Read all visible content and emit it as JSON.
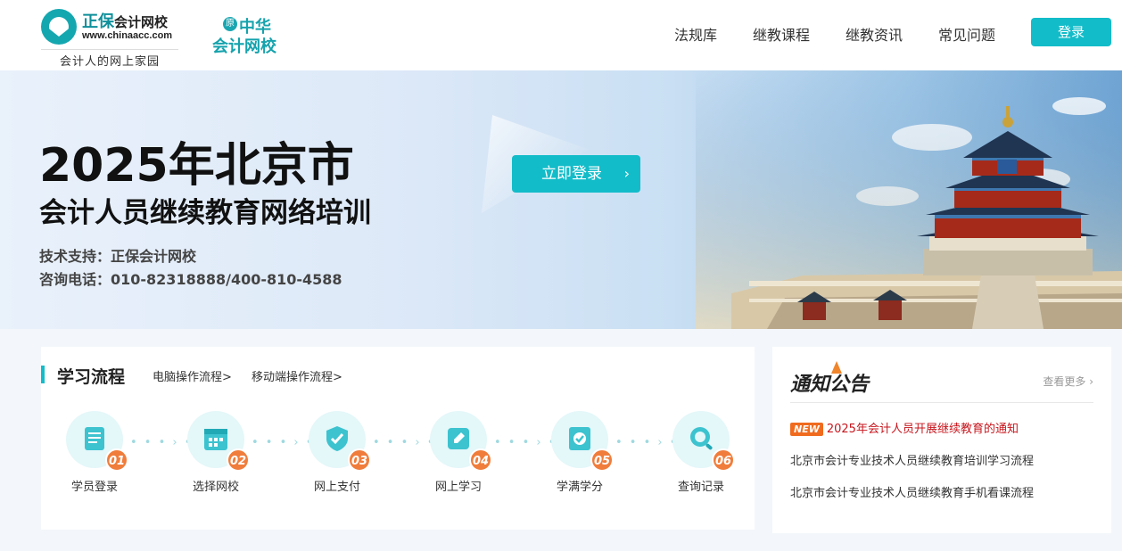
{
  "header": {
    "logo1_name": "正保",
    "logo1_name_suffix": "会计网校",
    "logo1_url": "www.chinaacc.com",
    "logo1_slogan": "会计人的网上家园",
    "logo2_badge": "原",
    "logo2_top": "中华",
    "logo2_bottom": "会计网校",
    "nav": [
      "法规库",
      "继教课程",
      "继教资讯",
      "常见问题"
    ],
    "login_label": "登录"
  },
  "banner": {
    "title": "2025年北京市",
    "subtitle": "会计人员继续教育网络培训",
    "support": "技术支持：正保会计网校",
    "phone": "咨询电话：010-82318888/400-810-4588",
    "cta_label": "立即登录",
    "cta_arrow": "›"
  },
  "process": {
    "title": "学习流程",
    "links": [
      "电脑操作流程>",
      "移动端操作流程>"
    ],
    "dots": "• • • › • •",
    "steps": [
      {
        "num": "01",
        "label": "学员登录",
        "icon": "document-icon"
      },
      {
        "num": "02",
        "label": "选择网校",
        "icon": "calendar-icon"
      },
      {
        "num": "03",
        "label": "网上支付",
        "icon": "shield-check-icon"
      },
      {
        "num": "04",
        "label": "网上学习",
        "icon": "edit-icon"
      },
      {
        "num": "05",
        "label": "学满学分",
        "icon": "certificate-icon"
      },
      {
        "num": "06",
        "label": "查询记录",
        "icon": "search-icon"
      }
    ]
  },
  "notice": {
    "title": "通知公告",
    "more": "查看更多",
    "new_badge": "NEW",
    "items": [
      "2025年会计人员开展继续教育的通知",
      "北京市会计专业技术人员继续教育培训学习流程",
      "北京市会计专业技术人员继续教育手机看课流程"
    ]
  },
  "colors": {
    "accent": "#13bcc9",
    "step_number": "#f07d3b",
    "hot_notice": "#c7161d",
    "new_badge": "#f06b1e"
  }
}
